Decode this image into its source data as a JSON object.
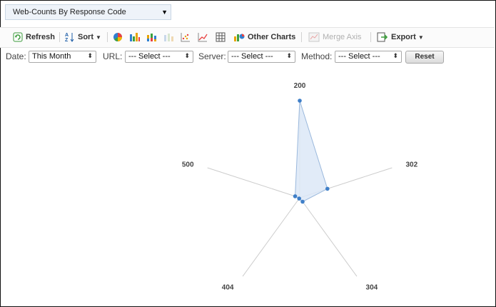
{
  "report_selector": {
    "value": "Web-Counts By Response Code",
    "arrow": "▼"
  },
  "toolbar": {
    "refresh_label": "Refresh",
    "sort_label": "Sort",
    "other_charts_label": "Other Charts",
    "merge_axis_label": "Merge Axis",
    "export_label": "Export"
  },
  "filters": {
    "date_label": "Date:",
    "date_value": "This Month",
    "url_label": "URL:",
    "url_value": "--- Select ---",
    "server_label": "Server:",
    "server_value": "--- Select ---",
    "method_label": "Method:",
    "method_value": "--- Select ---",
    "reset_label": "Reset"
  },
  "colors": {
    "series_stroke": "#9ab8dc",
    "series_fill": "#dce8f7",
    "point": "#3f7fc8",
    "axis": "#cccccc"
  },
  "chart_data": {
    "type": "radar",
    "categories": [
      "200",
      "302",
      "304",
      "404",
      "500"
    ],
    "series": [
      {
        "values": [
          100,
          30,
          5,
          1,
          5
        ]
      }
    ],
    "rmax": 100,
    "grid": false
  }
}
